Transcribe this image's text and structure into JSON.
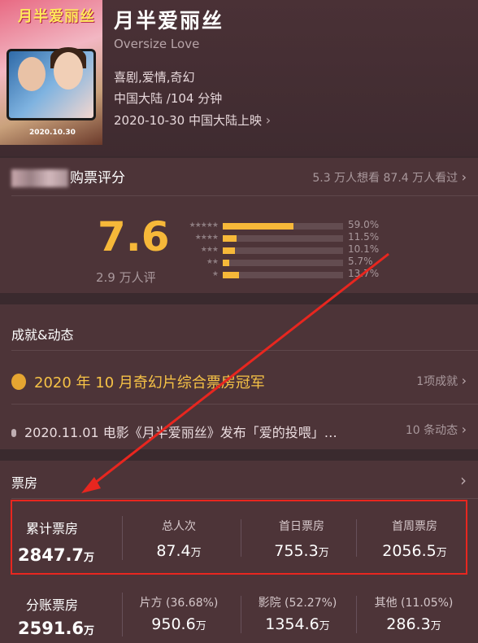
{
  "movie": {
    "poster_title": "月半爱丽丝",
    "poster_date": "2020.10.30",
    "title": "月半爱丽丝",
    "english_title": "Oversize Love",
    "genres": "喜剧,爱情,奇幻",
    "region_runtime": "中国大陆 /104 分钟",
    "release": "2020-10-30 中国大陆上映"
  },
  "rating": {
    "header_label": "购票评分",
    "want_watched": "5.3 万人想看  87.4 万人看过",
    "score": "7.6",
    "count": "2.9 万人评",
    "distribution": [
      {
        "stars": "★★★★★",
        "percent": 59.0,
        "label": "59.0%"
      },
      {
        "stars": "★★★★",
        "percent": 11.5,
        "label": "11.5%"
      },
      {
        "stars": "★★★",
        "percent": 10.1,
        "label": "10.1%"
      },
      {
        "stars": "★★",
        "percent": 5.7,
        "label": "5.7%"
      },
      {
        "stars": "★",
        "percent": 13.7,
        "label": "13.7%"
      }
    ]
  },
  "achievements": {
    "title": "成就&动态",
    "main": "2020 年 10 月奇幻片综合票房冠军",
    "main_count": "1项成就",
    "news": "2020.11.01 电影《月半爱丽丝》发布「爱的投喂」…",
    "news_count": "10 条动态"
  },
  "box_office": {
    "title": "票房",
    "row1": {
      "total_label": "累计票房",
      "total_value": "2847.7",
      "total_unit": "万",
      "items": [
        {
          "label": "总人次",
          "value": "87.4",
          "unit": "万"
        },
        {
          "label": "首日票房",
          "value": "755.3",
          "unit": "万"
        },
        {
          "label": "首周票房",
          "value": "2056.5",
          "unit": "万"
        }
      ]
    },
    "row2": {
      "total_label": "分账票房",
      "total_value": "2591.6",
      "total_unit": "万",
      "items": [
        {
          "label": "片方 (36.68%)",
          "value": "950.6",
          "unit": "万"
        },
        {
          "label": "影院 (52.27%)",
          "value": "1354.6",
          "unit": "万"
        },
        {
          "label": "其他 (11.05%)",
          "value": "286.3",
          "unit": "万"
        }
      ]
    }
  },
  "colors": {
    "accent": "#f6b839",
    "annotation": "#e8261f",
    "background": "#3a2a2e"
  }
}
